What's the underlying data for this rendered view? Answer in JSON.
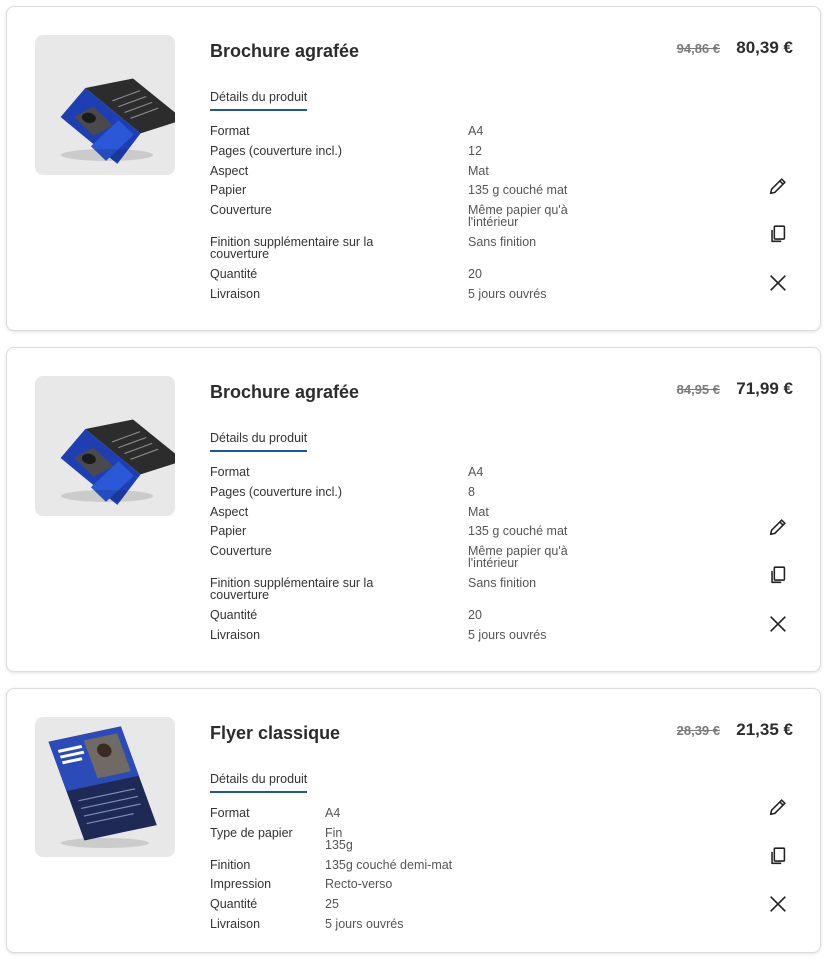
{
  "cart": [
    {
      "title": "Brochure agrafée",
      "price_old": "94,86 €",
      "price_new": "80,39 €",
      "details_label": "Détails du produit",
      "specs": [
        {
          "label": "Format",
          "value": "A4"
        },
        {
          "label": "Pages (couverture incl.)",
          "value": "12"
        },
        {
          "label": "Aspect",
          "value": "Mat"
        },
        {
          "label": "Papier",
          "value": "135 g couché mat"
        },
        {
          "label": "Couverture",
          "value": "Même papier qu'à\nl'intérieur"
        },
        {
          "label": "Finition supplémentaire sur la\ncouverture",
          "value": "Sans finition"
        },
        {
          "label": "Quantité",
          "value": "20"
        },
        {
          "label": "Livraison",
          "value": "5 jours ouvrés"
        }
      ]
    },
    {
      "title": "Brochure agrafée",
      "price_old": "84,95 €",
      "price_new": "71,99 €",
      "details_label": "Détails du produit",
      "specs": [
        {
          "label": "Format",
          "value": "A4"
        },
        {
          "label": "Pages (couverture incl.)",
          "value": "8"
        },
        {
          "label": "Aspect",
          "value": "Mat"
        },
        {
          "label": "Papier",
          "value": "135 g couché mat"
        },
        {
          "label": "Couverture",
          "value": "Même papier qu'à\nl'intérieur"
        },
        {
          "label": "Finition supplémentaire sur la\ncouverture",
          "value": "Sans finition"
        },
        {
          "label": "Quantité",
          "value": "20"
        },
        {
          "label": "Livraison",
          "value": "5 jours ouvrés"
        }
      ]
    },
    {
      "title": "Flyer classique",
      "price_old": "28,39 €",
      "price_new": "21,35 €",
      "details_label": "Détails du produit",
      "specs": [
        {
          "label": "Format",
          "value": "A4"
        },
        {
          "label": "Type de papier",
          "value": "Fin\n135g"
        },
        {
          "label": "Finition",
          "value": "135g couché demi-mat"
        },
        {
          "label": "Impression",
          "value": "Recto-verso"
        },
        {
          "label": "Quantité",
          "value": "25"
        },
        {
          "label": "Livraison",
          "value": "5 jours ouvrés"
        }
      ]
    }
  ],
  "icons": {
    "edit": "pencil-icon",
    "duplicate": "copy-icon",
    "remove": "close-icon"
  },
  "colors": {
    "accent": "#1e56a0",
    "text": "#2c2c2c",
    "muted": "#7a7a7a"
  }
}
